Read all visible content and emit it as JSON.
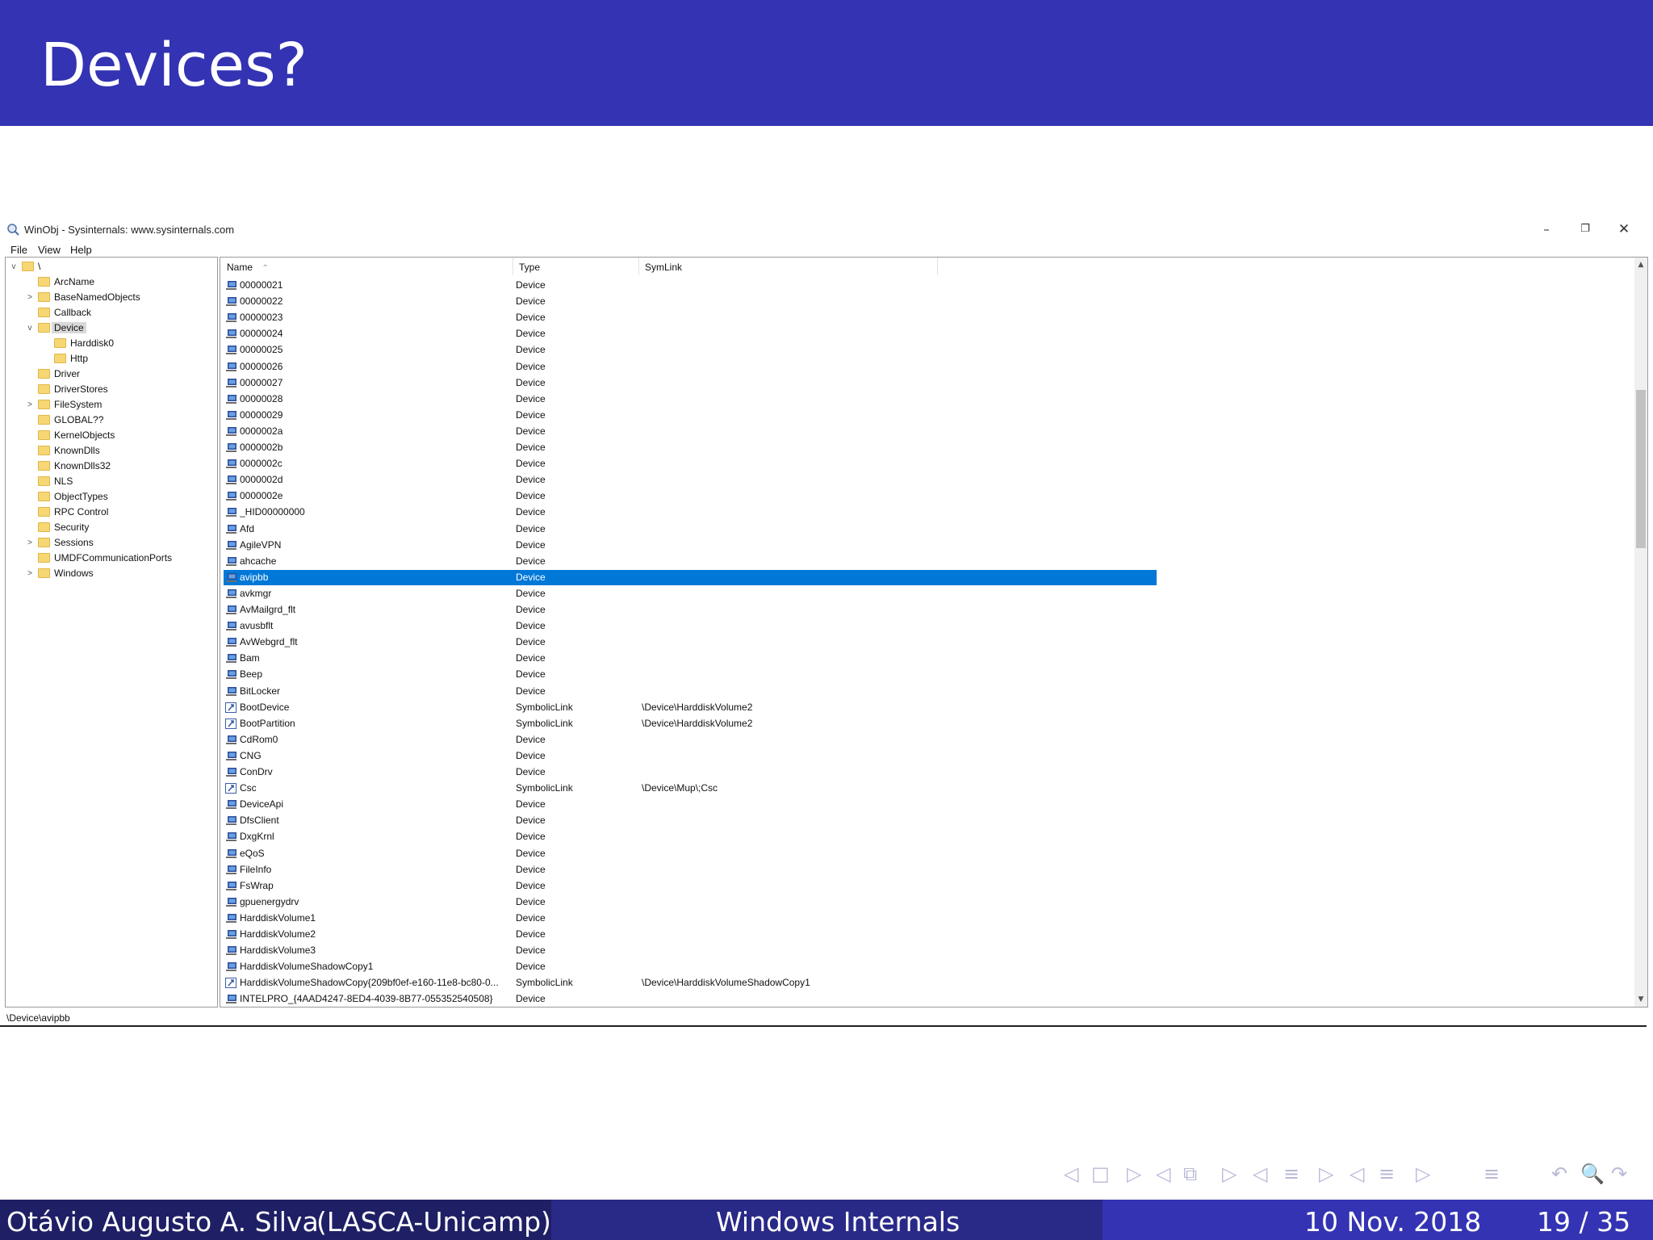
{
  "slide": {
    "title": "Devices?",
    "footer": {
      "author": "Otávio Augusto A. Silva",
      "affiliation": "(LASCA-Unicamp)",
      "talk_title": "Windows Internals",
      "date": "10 Nov. 2018",
      "page": "19 / 35"
    },
    "colors": {
      "header": "#3333b3",
      "footer_left": "#1f1f66",
      "footer_mid": "#292988",
      "footer_right": "#3333b3"
    }
  },
  "window": {
    "title": "WinObj - Sysinternals: www.sysinternals.com",
    "controls": {
      "minimize": "–",
      "restore": "❐",
      "close": "✕"
    },
    "menu": [
      "File",
      "View",
      "Help"
    ],
    "status": "\\Device\\avipbb",
    "selection_color": "#0078d7"
  },
  "tree": [
    {
      "label": "\\",
      "expander": "v"
    },
    {
      "label": "ArcName",
      "expander": ""
    },
    {
      "label": "BaseNamedObjects",
      "expander": ">"
    },
    {
      "label": "Callback",
      "expander": ""
    },
    {
      "label": "Device",
      "expander": "v"
    },
    {
      "label": "Harddisk0",
      "expander": ""
    },
    {
      "label": "Http",
      "expander": ""
    },
    {
      "label": "Driver",
      "expander": ""
    },
    {
      "label": "DriverStores",
      "expander": ""
    },
    {
      "label": "FileSystem",
      "expander": ">"
    },
    {
      "label": "GLOBAL??",
      "expander": ""
    },
    {
      "label": "KernelObjects",
      "expander": ""
    },
    {
      "label": "KnownDlls",
      "expander": ""
    },
    {
      "label": "KnownDlls32",
      "expander": ""
    },
    {
      "label": "NLS",
      "expander": ""
    },
    {
      "label": "ObjectTypes",
      "expander": ""
    },
    {
      "label": "RPC Control",
      "expander": ""
    },
    {
      "label": "Security",
      "expander": ""
    },
    {
      "label": "Sessions",
      "expander": ">"
    },
    {
      "label": "UMDFCommunicationPorts",
      "expander": ""
    },
    {
      "label": "Windows",
      "expander": ">"
    }
  ],
  "list": {
    "columns": {
      "name": "Name",
      "type": "Type",
      "symlink": "SymLink",
      "sort_indicator": "⌃"
    },
    "rows": [
      {
        "name": "00000021",
        "type": "Device",
        "symlink": ""
      },
      {
        "name": "00000022",
        "type": "Device",
        "symlink": ""
      },
      {
        "name": "00000023",
        "type": "Device",
        "symlink": ""
      },
      {
        "name": "00000024",
        "type": "Device",
        "symlink": ""
      },
      {
        "name": "00000025",
        "type": "Device",
        "symlink": ""
      },
      {
        "name": "00000026",
        "type": "Device",
        "symlink": ""
      },
      {
        "name": "00000027",
        "type": "Device",
        "symlink": ""
      },
      {
        "name": "00000028",
        "type": "Device",
        "symlink": ""
      },
      {
        "name": "00000029",
        "type": "Device",
        "symlink": ""
      },
      {
        "name": "0000002a",
        "type": "Device",
        "symlink": ""
      },
      {
        "name": "0000002b",
        "type": "Device",
        "symlink": ""
      },
      {
        "name": "0000002c",
        "type": "Device",
        "symlink": ""
      },
      {
        "name": "0000002d",
        "type": "Device",
        "symlink": ""
      },
      {
        "name": "0000002e",
        "type": "Device",
        "symlink": ""
      },
      {
        "name": "_HID00000000",
        "type": "Device",
        "symlink": ""
      },
      {
        "name": "Afd",
        "type": "Device",
        "symlink": ""
      },
      {
        "name": "AgileVPN",
        "type": "Device",
        "symlink": ""
      },
      {
        "name": "ahcache",
        "type": "Device",
        "symlink": ""
      },
      {
        "name": "avipbb",
        "type": "Device",
        "symlink": "",
        "selected": true
      },
      {
        "name": "avkmgr",
        "type": "Device",
        "symlink": ""
      },
      {
        "name": "AvMailgrd_flt",
        "type": "Device",
        "symlink": ""
      },
      {
        "name": "avusbflt",
        "type": "Device",
        "symlink": ""
      },
      {
        "name": "AvWebgrd_flt",
        "type": "Device",
        "symlink": ""
      },
      {
        "name": "Bam",
        "type": "Device",
        "symlink": ""
      },
      {
        "name": "Beep",
        "type": "Device",
        "symlink": ""
      },
      {
        "name": "BitLocker",
        "type": "Device",
        "symlink": ""
      },
      {
        "name": "BootDevice",
        "type": "SymbolicLink",
        "symlink": "\\Device\\HarddiskVolume2"
      },
      {
        "name": "BootPartition",
        "type": "SymbolicLink",
        "symlink": "\\Device\\HarddiskVolume2"
      },
      {
        "name": "CdRom0",
        "type": "Device",
        "symlink": ""
      },
      {
        "name": "CNG",
        "type": "Device",
        "symlink": ""
      },
      {
        "name": "ConDrv",
        "type": "Device",
        "symlink": ""
      },
      {
        "name": "Csc",
        "type": "SymbolicLink",
        "symlink": "\\Device\\Mup\\;Csc"
      },
      {
        "name": "DeviceApi",
        "type": "Device",
        "symlink": ""
      },
      {
        "name": "DfsClient",
        "type": "Device",
        "symlink": ""
      },
      {
        "name": "DxgKrnl",
        "type": "Device",
        "symlink": ""
      },
      {
        "name": "eQoS",
        "type": "Device",
        "symlink": ""
      },
      {
        "name": "FileInfo",
        "type": "Device",
        "symlink": ""
      },
      {
        "name": "FsWrap",
        "type": "Device",
        "symlink": ""
      },
      {
        "name": "gpuenergydrv",
        "type": "Device",
        "symlink": ""
      },
      {
        "name": "HarddiskVolume1",
        "type": "Device",
        "symlink": ""
      },
      {
        "name": "HarddiskVolume2",
        "type": "Device",
        "symlink": ""
      },
      {
        "name": "HarddiskVolume3",
        "type": "Device",
        "symlink": ""
      },
      {
        "name": "HarddiskVolumeShadowCopy1",
        "type": "Device",
        "symlink": ""
      },
      {
        "name": "HarddiskVolumeShadowCopy{209bf0ef-e160-11e8-bc80-0...",
        "type": "SymbolicLink",
        "symlink": "\\Device\\HarddiskVolumeShadowCopy1"
      },
      {
        "name": "INTELPRO_{4AAD4247-8ED4-4039-8B77-055352540508}",
        "type": "Device",
        "symlink": ""
      }
    ]
  },
  "nav_symbols": [
    "◁",
    "□",
    "▷",
    "◁",
    "⧉",
    "▷",
    "◁",
    "≡",
    "▷",
    "◁",
    "≡",
    "▷",
    "≡",
    "↶",
    "🔍",
    "↷"
  ]
}
